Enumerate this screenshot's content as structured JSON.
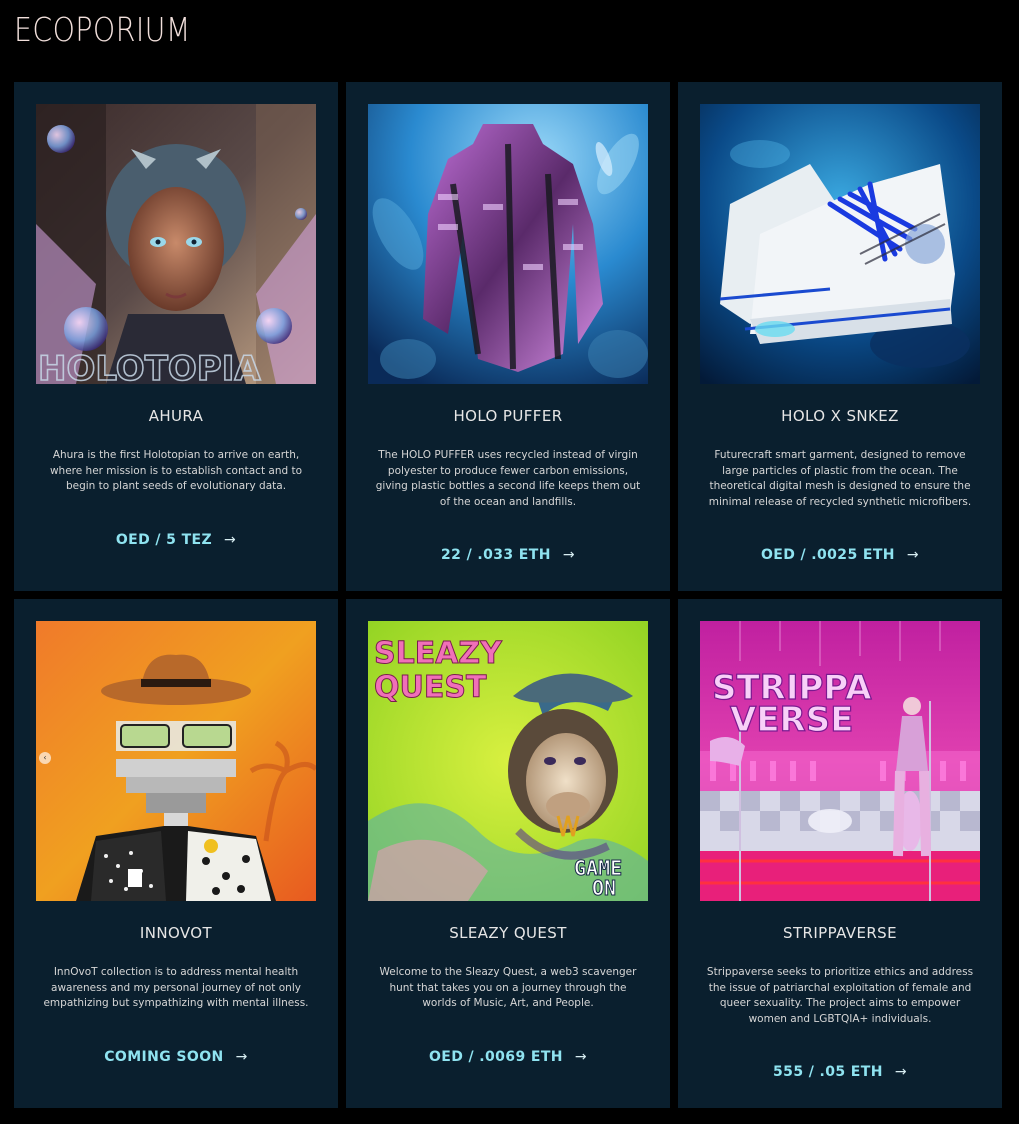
{
  "site": {
    "title": "ECOPORIUM"
  },
  "cards": [
    {
      "name": "AHURA",
      "description": "Ahura is the first Holotopian to arrive on earth, where her mission is to establish contact and to begin to plant seeds of evolutionary data.",
      "cta": "OED / 5 TEZ",
      "image_text": "HOLOTOPIA"
    },
    {
      "name": "HOLO PUFFER",
      "description": "The HOLO PUFFER uses recycled instead of virgin polyester to produce fewer carbon emissions, giving plastic bottles a second life keeps them out of the ocean and landfills.",
      "cta": "22 / .033 ETH"
    },
    {
      "name": "HOLO X SNKEZ",
      "description": "Futurecraft smart garment, designed to remove large particles of plastic from the ocean. The theoretical digital mesh is designed to ensure the minimal release of recycled synthetic microfibers.",
      "cta": "OED / .0025 ETH"
    },
    {
      "name": "INNOVOT",
      "description": "InnOvoT collection is to address mental health awareness and my personal journey of not only empathizing but sympathizing with mental illness.",
      "cta": "COMING SOON"
    },
    {
      "name": "SLEAZY QUEST",
      "description": "Welcome to the Sleazy Quest, a web3 scavenger hunt that takes you on a journey through the worlds of Music, Art, and People.",
      "cta": "OED / .0069 ETH",
      "image_text_top_1": "SLEAZY",
      "image_text_top_2": "QUEST",
      "image_text_bottom_1": "GAME",
      "image_text_bottom_2": "ON"
    },
    {
      "name": "STRIPPAVERSE",
      "description": "Strippaverse seeks to prioritize ethics and address the issue of patriarchal exploitation of female and queer sexuality. The project aims to empower women and LGBTQIA+ individuals.",
      "cta": "555 / .05 ETH",
      "image_text_1": "STRIPPA",
      "image_text_2": "VERSE"
    }
  ],
  "icons": {
    "cta_arrow": "arrow-right-icon",
    "carousel_prev": "chevron-left-icon"
  },
  "colors": {
    "background": "#000000",
    "card": "#0a1f2e",
    "accent": "#8fe3f0",
    "title": "#f2e0dc"
  }
}
